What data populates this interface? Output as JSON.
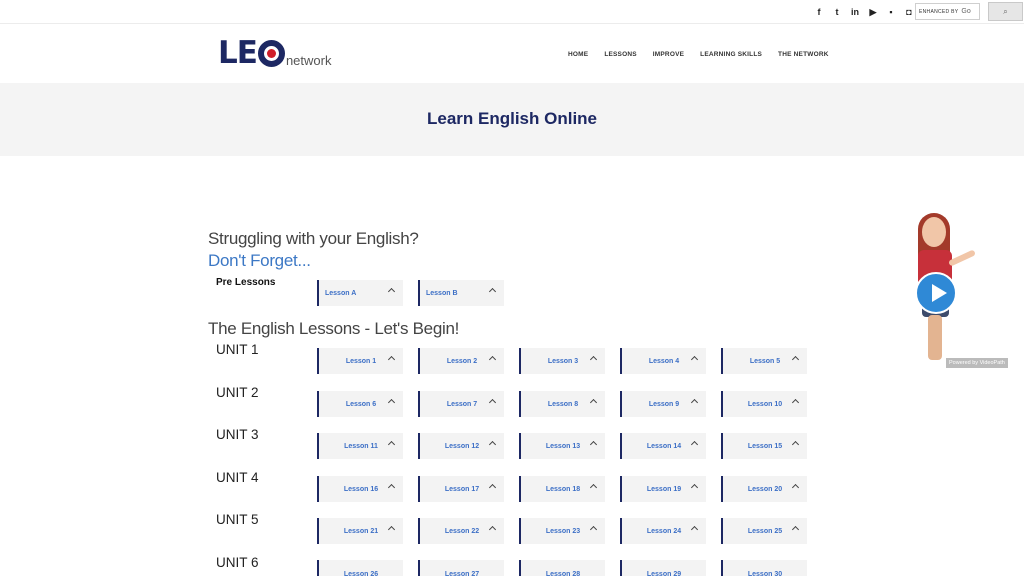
{
  "topbar": {
    "social_icons": [
      "facebook-icon",
      "twitter-icon",
      "linkedin-icon",
      "youtube-icon",
      "flickr-icon",
      "discord-icon"
    ],
    "search_label": "ENHANCED BY",
    "search_brand": "Go"
  },
  "header": {
    "logo_main": "LE",
    "logo_sub": "network",
    "nav": [
      "HOME",
      "LESSONS",
      "IMPROVE",
      "LEARNING SKILLS",
      "THE NETWORK"
    ]
  },
  "hero": {
    "title": "Learn English Online"
  },
  "content": {
    "struggling": "Struggling with your English?",
    "dont_forget": "Don't Forget...",
    "pre_label": "Pre Lessons",
    "pre_lessons": [
      "Lesson A",
      "Lesson B"
    ],
    "lessons_heading": "The English Lessons - Let's Begin!",
    "units": [
      {
        "label": "UNIT 1",
        "lessons": [
          "Lesson 1",
          "Lesson 2",
          "Lesson 3",
          "Lesson 4",
          "Lesson 5"
        ]
      },
      {
        "label": "UNIT 2",
        "lessons": [
          "Lesson 6",
          "Lesson 7",
          "Lesson 8",
          "Lesson 9",
          "Lesson 10"
        ]
      },
      {
        "label": "UNIT 3",
        "lessons": [
          "Lesson 11",
          "Lesson 12",
          "Lesson 13",
          "Lesson 14",
          "Lesson 15"
        ]
      },
      {
        "label": "UNIT 4",
        "lessons": [
          "Lesson 16",
          "Lesson 17",
          "Lesson 18",
          "Lesson 19",
          "Lesson 20"
        ]
      },
      {
        "label": "UNIT 5",
        "lessons": [
          "Lesson 21",
          "Lesson 22",
          "Lesson 23",
          "Lesson 24",
          "Lesson 25"
        ]
      },
      {
        "label": "UNIT 6",
        "lessons": [
          "Lesson 26",
          "Lesson 27",
          "Lesson 28",
          "Lesson 29",
          "Lesson 30"
        ]
      }
    ]
  },
  "widget": {
    "powered_by": "Powered by VideoPath"
  },
  "colors": {
    "brand_navy": "#1d2863",
    "brand_red": "#d01f2a",
    "link_blue": "#3c6fc6",
    "play_blue": "#2f89d6"
  }
}
